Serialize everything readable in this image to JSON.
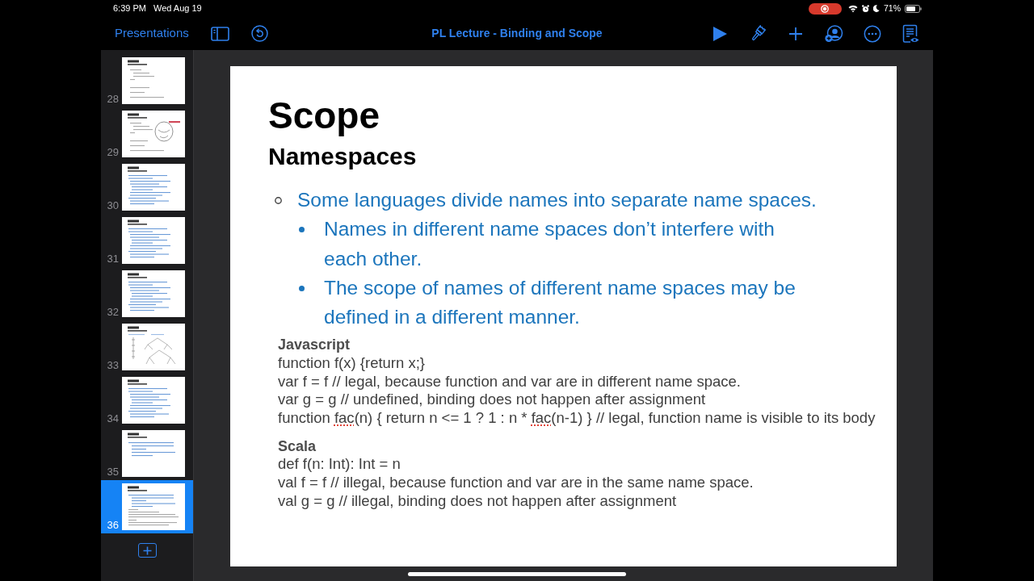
{
  "status_bar": {
    "time": "6:39 PM",
    "date": "Wed Aug 19",
    "battery": "71%"
  },
  "toolbar": {
    "back_link": "Presentations",
    "title": "PL Lecture - Binding and Scope"
  },
  "sidebar": {
    "slides": [
      {
        "number": "28",
        "kind": "code",
        "selected": false
      },
      {
        "number": "29",
        "kind": "doodle",
        "selected": false
      },
      {
        "number": "30",
        "kind": "bullets",
        "selected": false
      },
      {
        "number": "31",
        "kind": "bullets",
        "selected": false
      },
      {
        "number": "32",
        "kind": "bullets",
        "selected": false
      },
      {
        "number": "33",
        "kind": "tree",
        "selected": false
      },
      {
        "number": "34",
        "kind": "bullets",
        "selected": false
      },
      {
        "number": "35",
        "kind": "short_bullets",
        "selected": false
      },
      {
        "number": "36",
        "kind": "bullets_code",
        "selected": true
      }
    ]
  },
  "slide": {
    "title": "Scope",
    "subtitle": "Namespaces",
    "bullets": [
      {
        "text": "Some languages divide names into separate name spaces.",
        "children": [
          {
            "text": "Names in different name spaces don’t interfere with each other."
          },
          {
            "text": "The scope of names of different name spaces may be defined in a different manner."
          }
        ]
      }
    ],
    "code_sections": [
      {
        "heading": "Javascript",
        "lines": [
          {
            "parts": [
              {
                "text": "function f(x) {return x;}",
                "misspelled": false
              }
            ]
          },
          {
            "parts": [
              {
                "text": "var f = f // legal, because function and var are in different name space.",
                "misspelled": false
              }
            ]
          },
          {
            "parts": [
              {
                "text": "var g = g // undefined, binding does not happen after assignment",
                "misspelled": false
              }
            ]
          },
          {
            "parts": [
              {
                "text": "function ",
                "misspelled": false
              },
              {
                "text": "fac",
                "misspelled": true
              },
              {
                "text": "(n) { return n <= 1 ? 1 : n * ",
                "misspelled": false
              },
              {
                "text": "fac",
                "misspelled": true
              },
              {
                "text": "(n-1) } // legal, function name is visible to its body",
                "misspelled": false
              }
            ]
          }
        ]
      },
      {
        "heading": "Scala",
        "lines": [
          {
            "parts": [
              {
                "text": "def f(n: Int): Int = n",
                "misspelled": false
              }
            ]
          },
          {
            "parts": [
              {
                "text": "val f = f // illegal, because function and var are in the same name space.",
                "misspelled": false
              }
            ]
          },
          {
            "parts": [
              {
                "text": "val g = g // illegal, binding does not happen after assignment",
                "misspelled": false
              }
            ]
          }
        ]
      }
    ]
  }
}
